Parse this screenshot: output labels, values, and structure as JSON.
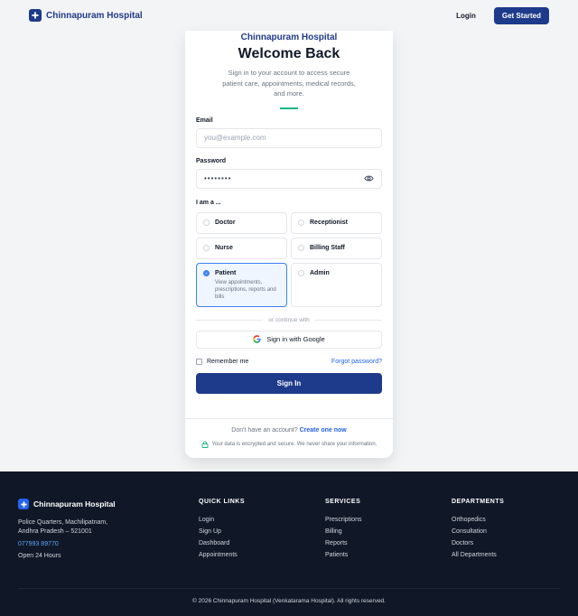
{
  "header": {
    "brand": "Chinnapuram Hospital",
    "login_label": "Login",
    "cta_label": "Get Started"
  },
  "card": {
    "brand": "Chinnapuram Hospital",
    "title": "Welcome Back",
    "subtitle": "Sign in to your account to access secure patient care, appointments, medical records, and more.",
    "email": {
      "label": "Email",
      "placeholder": "you@example.com",
      "value": ""
    },
    "password": {
      "label": "Password",
      "value": "••••••••"
    },
    "role_label": "I am a ...",
    "roles": [
      {
        "name": "Doctor",
        "selected": false
      },
      {
        "name": "Receptionist",
        "selected": false
      },
      {
        "name": "Nurse",
        "selected": false
      },
      {
        "name": "Billing Staff",
        "selected": false
      },
      {
        "name": "Patient",
        "selected": true,
        "description": "View appointments, prescriptions, reports and bills"
      },
      {
        "name": "Admin",
        "selected": false
      }
    ],
    "divider_text": "or continue with",
    "google_label": "Sign in with Google",
    "remember_label": "Remember me",
    "forgot_label": "Forgot password?",
    "signin_label": "Sign In",
    "signup_prompt": "Don't have an account?",
    "signup_link": "Create one now",
    "secure_note": "Your data is encrypted and secure. We never share your information."
  },
  "footer": {
    "brand": "Chinnapuram Hospital",
    "address_line1": "Police Quarters, Machilipatnam,",
    "address_line2": "Andhra Pradesh – 521001",
    "phone": "077993 89770",
    "hours": "Open 24 Hours",
    "quick_links": {
      "heading": "QUICK LINKS",
      "items": [
        "Login",
        "Sign Up",
        "Dashboard",
        "Appointments"
      ]
    },
    "services": {
      "heading": "SERVICES",
      "items": [
        "Prescriptions",
        "Billing",
        "Reports",
        "Patients"
      ]
    },
    "departments": {
      "heading": "DEPARTMENTS",
      "items": [
        "Orthopedics",
        "Consultation",
        "Doctors",
        "All Departments"
      ]
    },
    "copyright": "© 2026 Chinnapuram Hospital (Venkatarama Hospital). All rights reserved."
  },
  "colors": {
    "primary": "#1e3a8a",
    "accent": "#10b981",
    "link": "#2563eb",
    "footer_bg": "#101828"
  }
}
